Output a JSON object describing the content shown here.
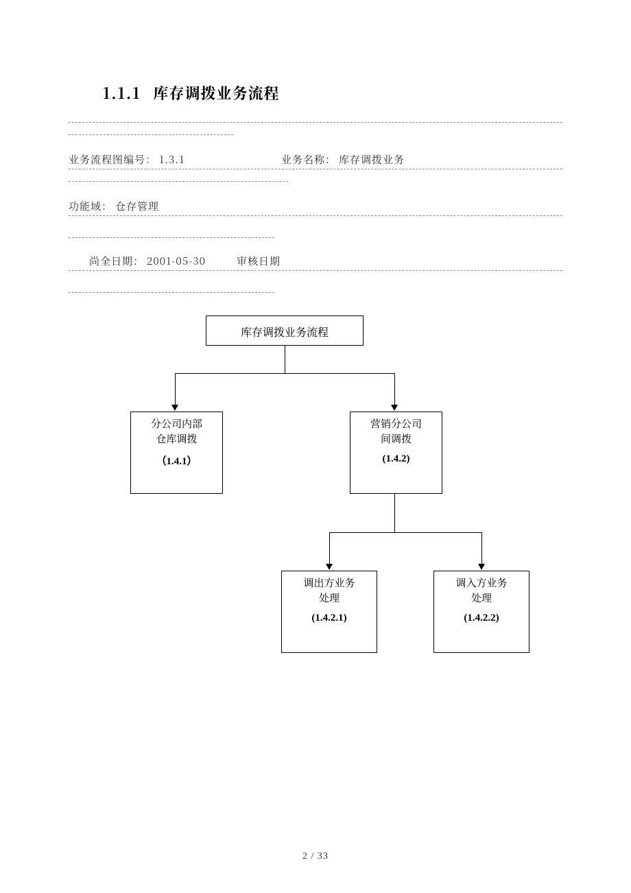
{
  "heading": {
    "number": "1.1.1",
    "title": "库存调拨业务流程"
  },
  "meta": {
    "flow_no_label": "业务流程图编号：",
    "flow_no_value": "1.3.1",
    "biz_name_label": "业务名称：",
    "biz_name_value": "库存调拨业务",
    "domain_label": "功能域：",
    "domain_value": "仓存管理",
    "complete_date_label": "尚全日期：",
    "complete_date_value": "2001-05-30",
    "review_date_label": "审核日期"
  },
  "diagram": {
    "root": "库存调拨业务流程",
    "n1": {
      "line1": "分公司内部",
      "line2": "仓库调拨",
      "code": "（1.4.1）"
    },
    "n2": {
      "line1": "营销分公司",
      "line2": "间调拨",
      "code": "(1.4.2)"
    },
    "n3": {
      "line1": "调出方业务",
      "line2": "处理",
      "code": "(1.4.2.1)"
    },
    "n4": {
      "line1": "调入方业务",
      "line2": "处理",
      "code": "(1.4.2.2)"
    }
  },
  "page_number": "2  / 33"
}
